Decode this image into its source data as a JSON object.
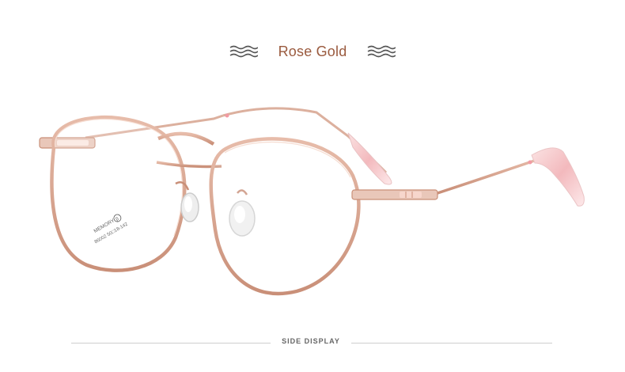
{
  "header": {
    "title": "Rose Gold",
    "left_ornament": "wave-lines-icon",
    "right_ornament": "wave-lines-icon"
  },
  "product": {
    "lens_text_line1": "MEMORY",
    "lens_badge": "β",
    "lens_text_line2": "86002 50□18-142"
  },
  "footer": {
    "label": "SIDE DISPLAY"
  },
  "colors": {
    "frame": "#d9a894",
    "frame_dark": "#c08a74",
    "title": "#9a5a3e",
    "tips": "#f4c2c4",
    "pad": "#e8e8e8",
    "ornament": "#555555"
  }
}
